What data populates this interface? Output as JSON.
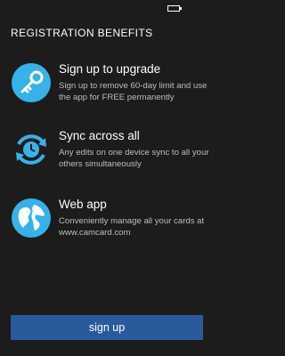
{
  "header": {
    "title": "REGISTRATION BENEFITS"
  },
  "accent_color": "#35b3e8",
  "button_color": "#2a5a9c",
  "benefits": [
    {
      "icon": "key-icon",
      "title": "Sign up to upgrade",
      "description": "Sign up to remove 60-day limit and use the app for FREE permanently"
    },
    {
      "icon": "sync-clock-icon",
      "title": "Sync across all",
      "description": "Any edits on one device sync to all your others simultaneously"
    },
    {
      "icon": "globe-icon",
      "title": "Web app",
      "description": "Conveniently manage all your cards at www.camcard.com"
    }
  ],
  "signup": {
    "label": "sign up"
  }
}
